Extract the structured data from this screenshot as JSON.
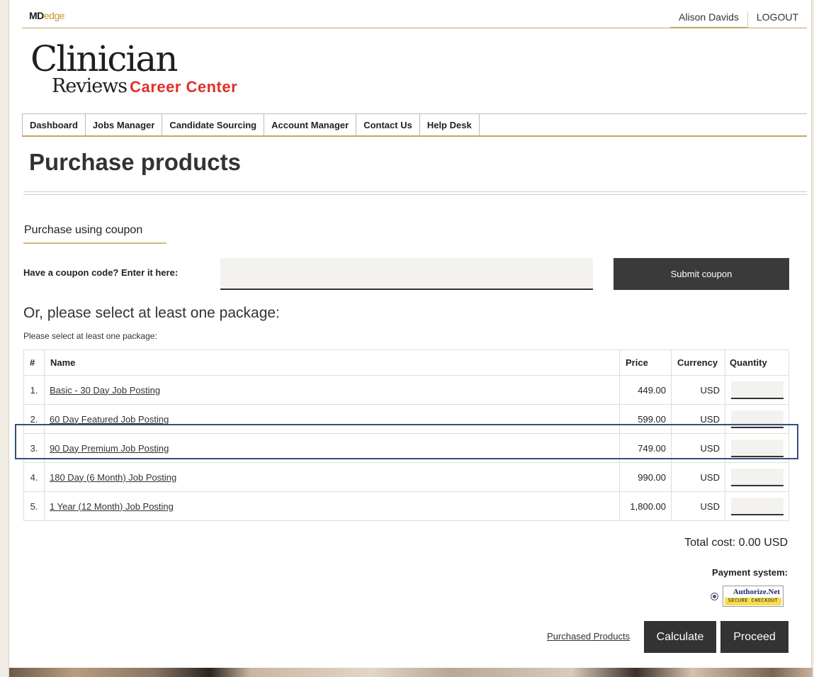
{
  "topbar": {
    "brand_md": "MD",
    "brand_edge": "edge",
    "user_name": "Alison Davids",
    "logout": "LOGOUT"
  },
  "logo": {
    "line1": "Clinician",
    "line2": "Reviews",
    "line2_suffix": "Career Center"
  },
  "nav": [
    "Dashboard",
    "Jobs Manager",
    "Candidate Sourcing",
    "Account Manager",
    "Contact Us",
    "Help Desk"
  ],
  "page_title": "Purchase products",
  "coupon": {
    "section_tab": "Purchase using coupon",
    "label": "Have a coupon code? Enter it here:",
    "value": "",
    "button": "Submit coupon"
  },
  "packages": {
    "heading": "Or, please select at least one package:",
    "note": "Please select at least one package:",
    "columns": [
      "#",
      "Name",
      "Price",
      "Currency",
      "Quantity"
    ],
    "rows": [
      {
        "num": "1.",
        "name": "Basic - 30 Day Job Posting",
        "price": "449.00",
        "currency": "USD",
        "qty": ""
      },
      {
        "num": "2.",
        "name": "60 Day Featured Job Posting",
        "price": "599.00",
        "currency": "USD",
        "qty": ""
      },
      {
        "num": "3.",
        "name": "90 Day Premium Job Posting",
        "price": "749.00",
        "currency": "USD",
        "qty": ""
      },
      {
        "num": "4.",
        "name": "180 Day (6 Month) Job Posting",
        "price": "990.00",
        "currency": "USD",
        "qty": ""
      },
      {
        "num": "5.",
        "name": "1 Year (12 Month) Job Posting",
        "price": "1,800.00",
        "currency": "USD",
        "qty": ""
      }
    ]
  },
  "total": "Total cost: 0.00 USD",
  "payment": {
    "label": "Payment system:",
    "provider_top": "Authorize.Net",
    "provider_bottom": "SECURE CHECKOUT",
    "selected": true
  },
  "actions": {
    "purchased_link": "Purchased Products",
    "calculate": "Calculate",
    "proceed": "Proceed"
  },
  "colors": {
    "accent_gold": "#c7a46a",
    "brand_red": "#e0302a",
    "dark_button": "#333333",
    "highlight_border": "#34507a"
  }
}
